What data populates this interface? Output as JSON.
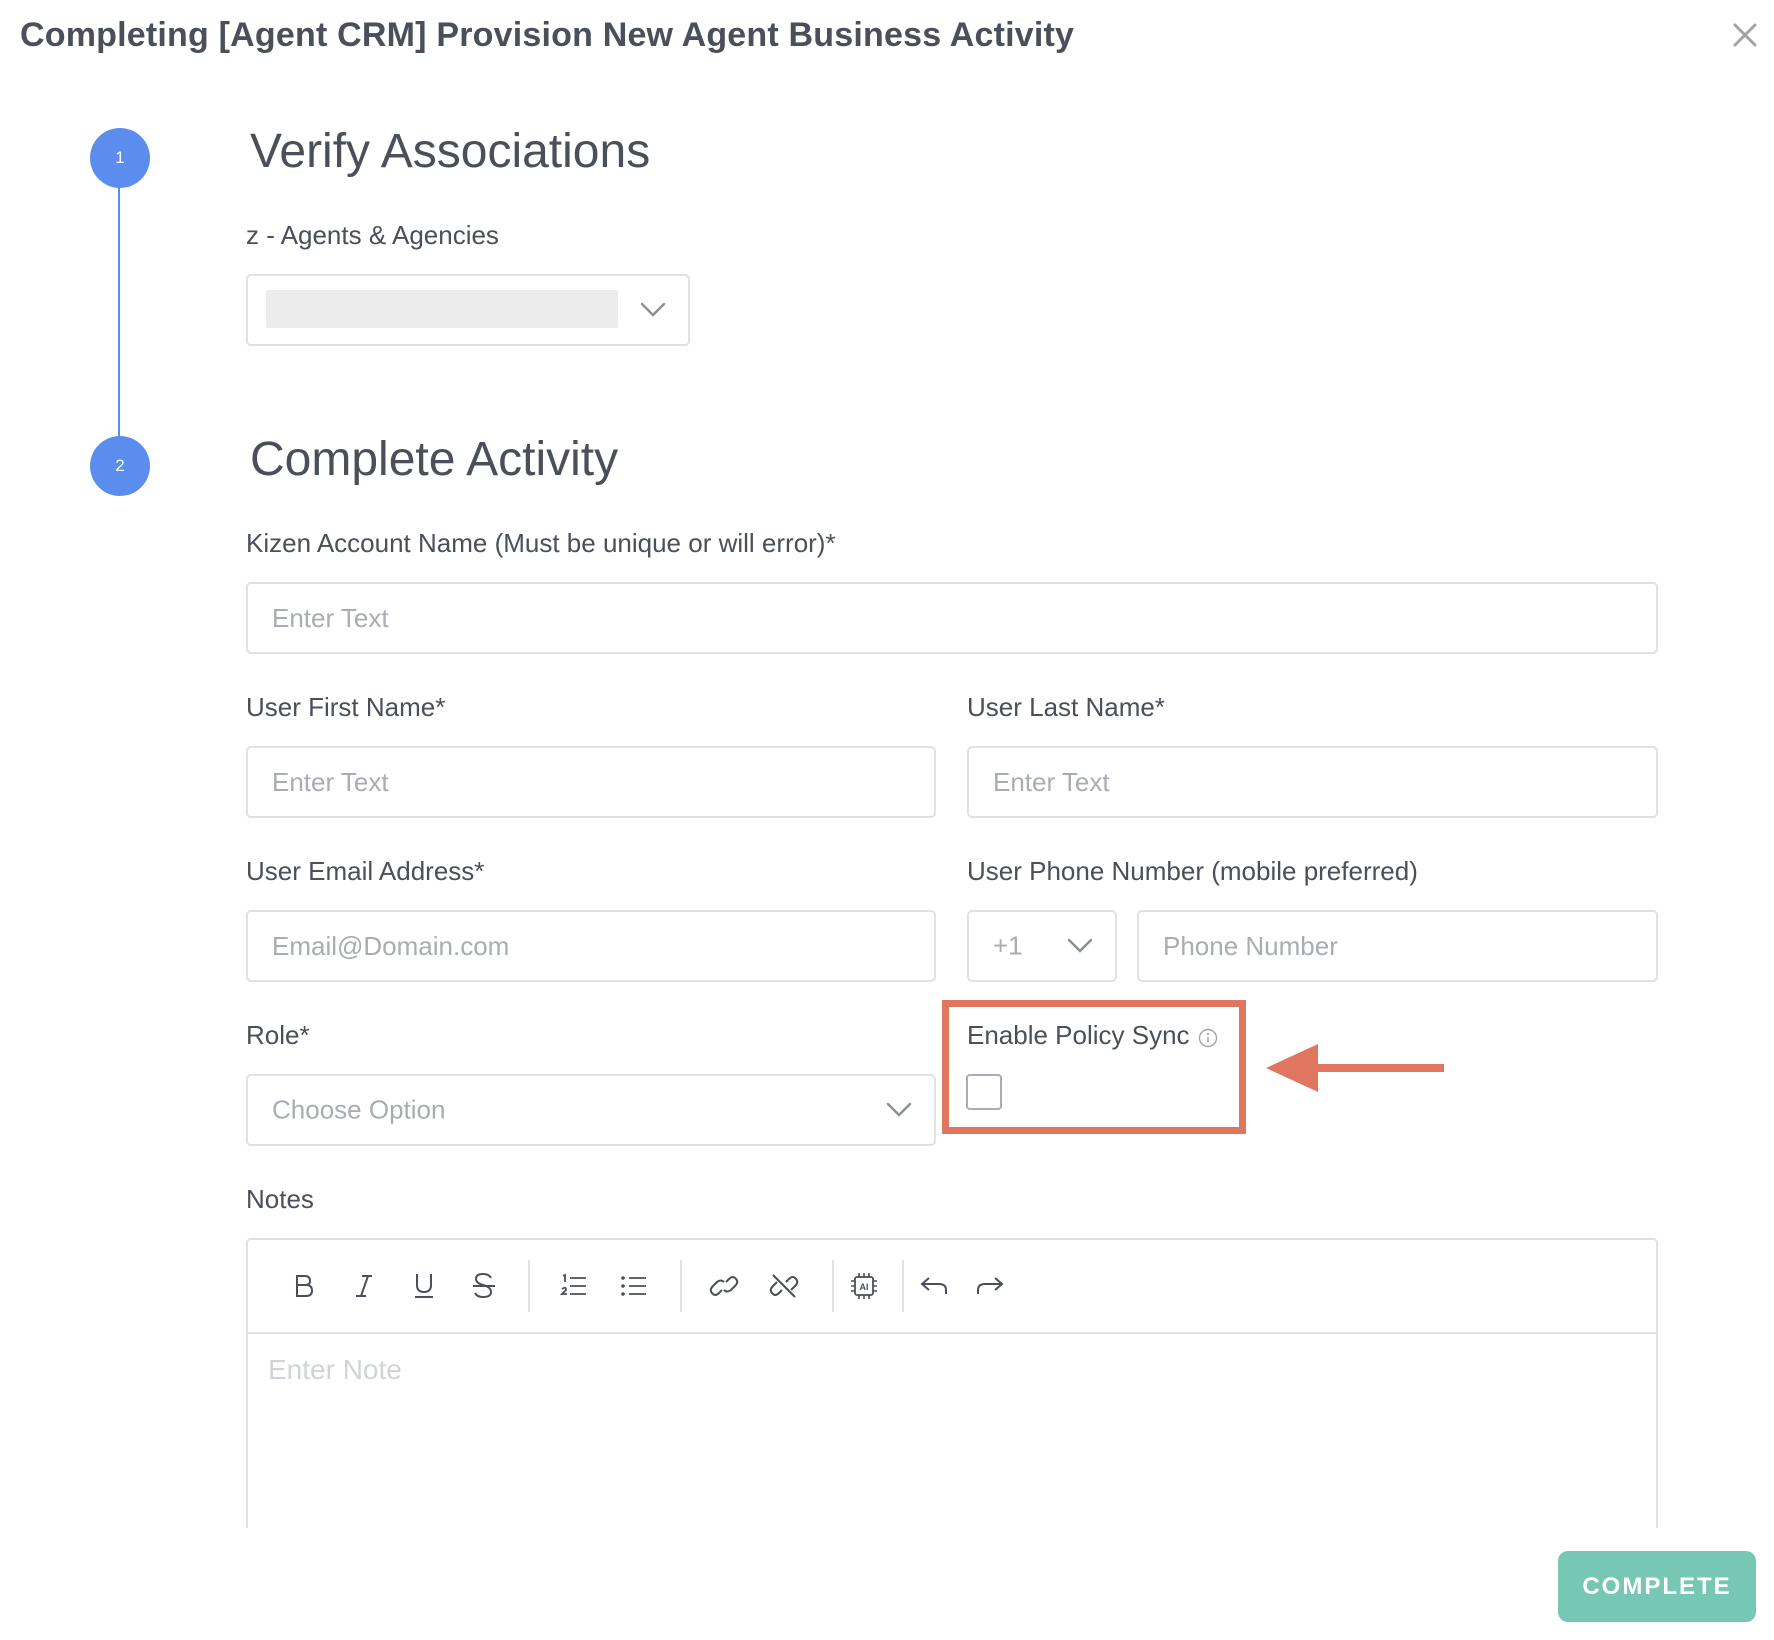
{
  "header": {
    "title": "Completing [Agent CRM] Provision New Agent Business Activity"
  },
  "steps": [
    {
      "number": "1",
      "title": "Verify Associations"
    },
    {
      "number": "2",
      "title": "Complete Activity"
    }
  ],
  "associations": {
    "label": "z - Agents & Agencies"
  },
  "form": {
    "account_name": {
      "label": "Kizen Account Name (Must be unique or will error)*",
      "placeholder": "Enter Text"
    },
    "first_name": {
      "label": "User First Name*",
      "placeholder": "Enter Text"
    },
    "last_name": {
      "label": "User Last Name*",
      "placeholder": "Enter Text"
    },
    "email": {
      "label": "User Email Address*",
      "placeholder": "Email@Domain.com"
    },
    "phone": {
      "label": "User Phone Number (mobile preferred)",
      "country_code": "+1",
      "placeholder": "Phone Number"
    },
    "role": {
      "label": "Role*",
      "placeholder": "Choose Option"
    },
    "policy_sync": {
      "label": "Enable Policy Sync",
      "checked": false
    },
    "notes": {
      "label": "Notes",
      "placeholder": "Enter Note"
    }
  },
  "toolbar": [
    "bold-icon",
    "italic-icon",
    "underline-icon",
    "strikethrough-icon",
    "ordered-list-icon",
    "bullet-list-icon",
    "link-icon",
    "unlink-icon",
    "ai-chip-icon",
    "undo-icon",
    "redo-icon"
  ],
  "actions": {
    "complete_label": "COMPLETE"
  },
  "colors": {
    "step_blue": "#5b8def",
    "highlight": "#e07660",
    "complete_green": "#76c7b3"
  }
}
